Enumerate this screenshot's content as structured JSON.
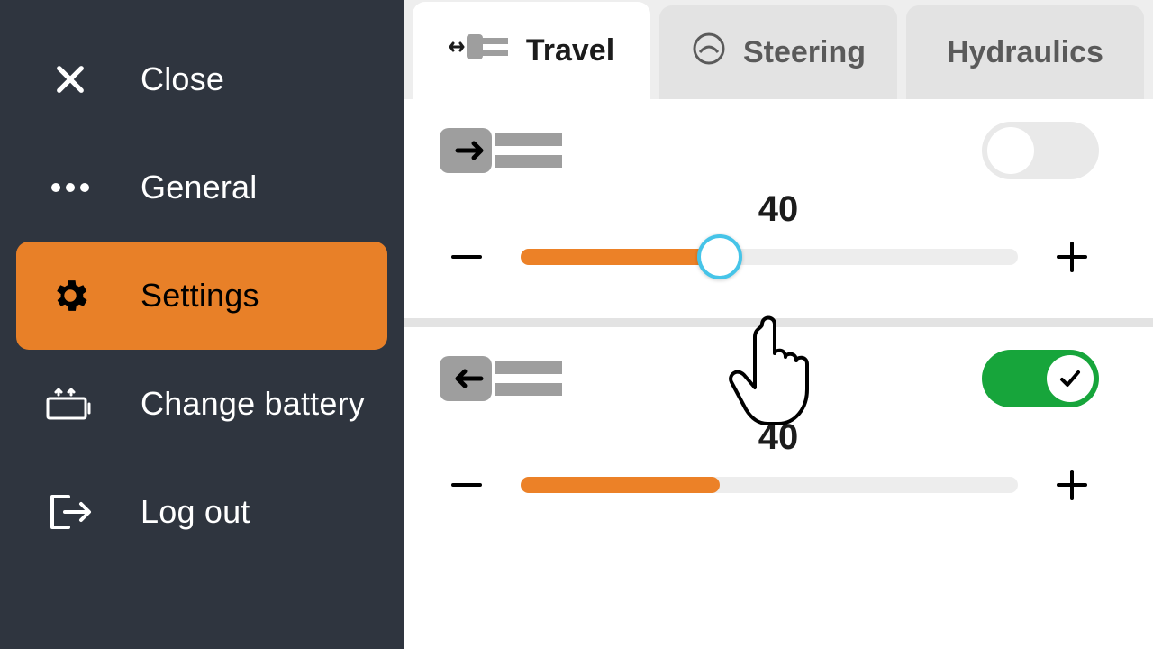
{
  "sidebar": {
    "items": [
      {
        "label": "Close"
      },
      {
        "label": "General"
      },
      {
        "label": "Settings"
      },
      {
        "label": "Change battery"
      },
      {
        "label": "Log out"
      }
    ],
    "active_index": 2
  },
  "tabs": {
    "items": [
      {
        "label": "Travel"
      },
      {
        "label": "Steering"
      },
      {
        "label": "Hydraulics"
      }
    ],
    "active_index": 0
  },
  "sections": [
    {
      "direction": "forward",
      "toggle": false,
      "value": "40",
      "slider_percent": 40,
      "touch_highlight": true
    },
    {
      "direction": "backward",
      "toggle": true,
      "value": "40",
      "slider_percent": 40,
      "touch_highlight": false
    }
  ],
  "colors": {
    "sidebar_bg": "#2f353f",
    "accent": "#e88028",
    "toggle_on": "#17a53b",
    "touch_ring": "#46c4e8"
  }
}
